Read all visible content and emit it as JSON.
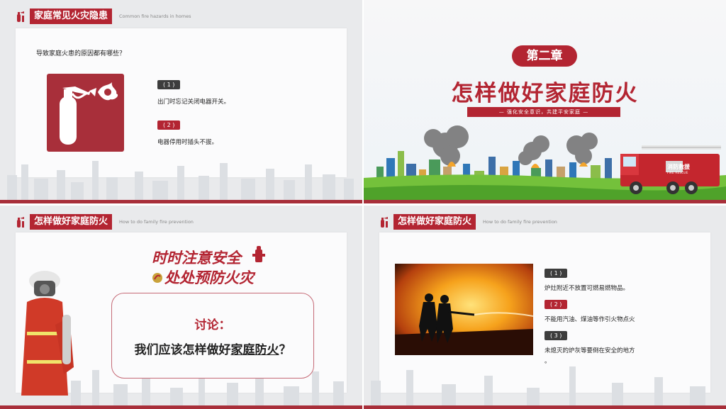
{
  "slide1": {
    "header": "家庭常见火灾隐患",
    "header_en": "Common fire hazards in homes",
    "question": "导致家庭火患的原因都有哪些？",
    "items": [
      {
        "num": "( 1 )",
        "text": "出门时忘记关闭电器开关。"
      },
      {
        "num": "( 2 )",
        "text": "电器停用时插头不拔。"
      }
    ]
  },
  "slide2": {
    "chapter": "第二章",
    "title": "怎样做好家庭防火",
    "subtitle": "— 强化安全意识，共建平安家庭 —",
    "truck_label": "消防救援",
    "truck_label_en": "FIRE RESCUE"
  },
  "slide3": {
    "header": "怎样做好家庭防火",
    "header_en": "How to do family fire prevention",
    "slogan1": "时时注意安全",
    "slogan2": "处处预防火灾",
    "discussion": "讨论：",
    "question_prefix": "我们应该怎样做好",
    "question_underlined": "家庭防火",
    "question_suffix": "？"
  },
  "slide4": {
    "header": "怎样做好家庭防火",
    "header_en": "How to do family fire prevention",
    "items": [
      {
        "num": "( 1 )",
        "text": "炉灶附近不放置可燃易燃物品。"
      },
      {
        "num": "( 2 )",
        "text": "不能用汽油、煤油等作引火物点火"
      },
      {
        "num": "( 3 )",
        "text": "未熄灭的炉灰等要倒在安全的地方"
      }
    ],
    "trailing": "。"
  },
  "colors": {
    "brand_red": "#b32532",
    "dark": "#3d3d3d"
  }
}
